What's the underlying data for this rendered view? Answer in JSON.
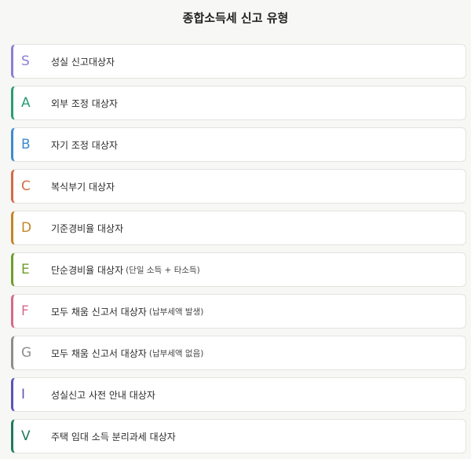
{
  "page": {
    "title": "종합소득세 신고 유형"
  },
  "items": [
    {
      "code": "S",
      "label": "성실 신고대상자",
      "note": "",
      "color": "#8b7fd6"
    },
    {
      "code": "A",
      "label": "외부 조정 대상자",
      "note": "",
      "color": "#2a9d74"
    },
    {
      "code": "B",
      "label": "자기 조정 대상자",
      "note": "",
      "color": "#3d8bd0"
    },
    {
      "code": "C",
      "label": "복식부기 대상자",
      "note": "",
      "color": "#d26b45"
    },
    {
      "code": "D",
      "label": "기준경비율 대상자",
      "note": "",
      "color": "#c58524"
    },
    {
      "code": "E",
      "label": "단순경비율 대상자",
      "note": "(단일 소득 + 타소득)",
      "color": "#6e9e2d"
    },
    {
      "code": "F",
      "label": "모두 채움 신고서 대상자",
      "note": "(납부세액 발생)",
      "color": "#d46a8c"
    },
    {
      "code": "G",
      "label": "모두 채움 신고서 대상자",
      "note": "(납부세액 없음)",
      "color": "#8e8e8a"
    },
    {
      "code": "I",
      "label": "성실신고 사전 안내 대상자",
      "note": "",
      "color": "#5b53b8"
    },
    {
      "code": "V",
      "label": "주택 임대 소득 분리과세 대상자",
      "note": "",
      "color": "#1f7a5e"
    }
  ]
}
